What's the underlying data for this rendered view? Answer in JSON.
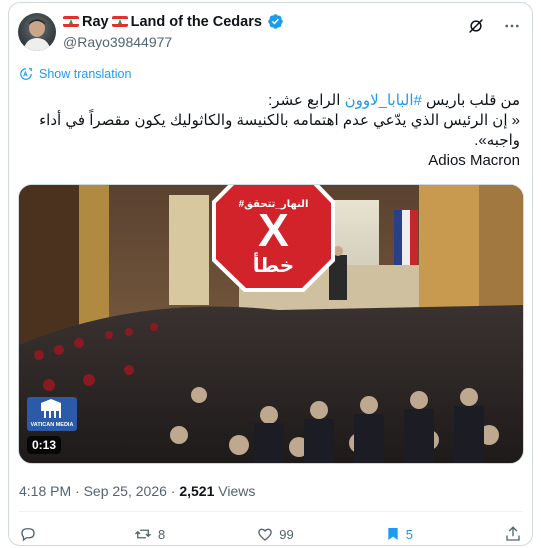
{
  "user": {
    "display_name": "RayLand of the Cedars",
    "handle": "@Rayo39844977",
    "verified": true
  },
  "icons": {
    "grok": "grok-icon",
    "more": "more-icon",
    "translate": "translate-icon",
    "reply": "reply-icon",
    "retweet": "retweet-icon",
    "like": "like-icon",
    "bookmark": "bookmark-icon",
    "share": "share-icon"
  },
  "translate_label": "Show translation",
  "tweet": {
    "line1_pre": "من قلب باريس ",
    "hashtag": "#البابا_لاوون",
    "line1_post": " الرابع عشر:",
    "line2": "« إن الرئيس الذي يدّعي عدم اهتمامه بالكنيسة والكاثوليك يكون مقصراً في أداء",
    "line3": "واجبه».",
    "line4": "Adios Macron"
  },
  "media": {
    "overlay_handle": "#النهار_تتحقق",
    "overlay_verdict": "خطأ",
    "duration": "0:13",
    "source_logo_text": "VATICAN MEDIA"
  },
  "meta": {
    "time": "4:18 PM",
    "date": "Sep 25, 2026",
    "views_count": "2,521",
    "views_label": "Views"
  },
  "actions": {
    "replies": "",
    "reposts": "8",
    "likes": "99",
    "bookmarks": "5"
  },
  "colors": {
    "accent": "#1d9bf0",
    "stop_red": "#d2232a",
    "text": "#0f1419",
    "muted": "#536471"
  }
}
